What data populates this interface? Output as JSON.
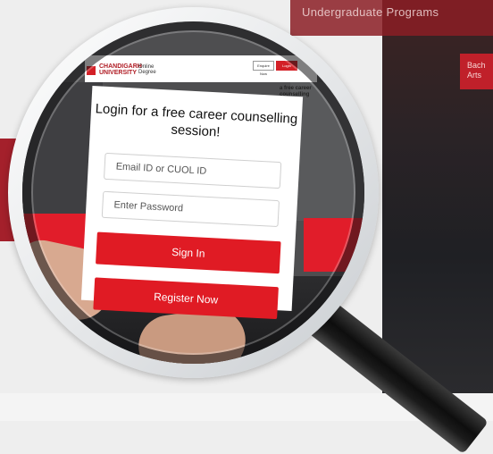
{
  "background": {
    "title": "Undergraduate Programs",
    "card_text": "Bach Arts",
    "colors": {
      "brand_red": "#e01b24",
      "dark": "#1f2024"
    }
  },
  "site_header": {
    "logo_text": "CHANDIGARH UNIVERSITY",
    "online_label": "Online Degree",
    "enquire_label": "Enquire Now",
    "login_label": "Login"
  },
  "side_snippet": "a free career counselling session!",
  "login_card": {
    "title": "Login for a free career counselling session!",
    "email_placeholder": "Email ID or CUOL ID",
    "password_placeholder": "Enter Password",
    "signin_label": "Sign In",
    "register_label": "Register Now"
  },
  "icons": [
    "magnifier-icon",
    "logo-icon"
  ]
}
